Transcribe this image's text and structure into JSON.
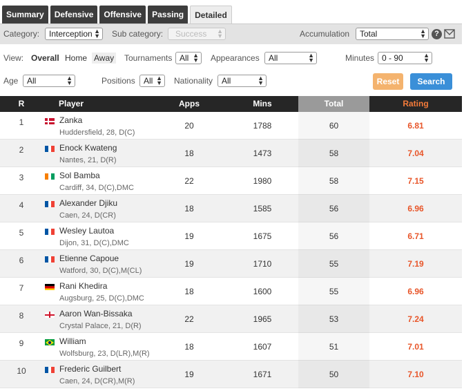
{
  "tabs": [
    {
      "label": "Summary",
      "active": false
    },
    {
      "label": "Defensive",
      "active": false
    },
    {
      "label": "Offensive",
      "active": false
    },
    {
      "label": "Passing",
      "active": false
    },
    {
      "label": "Detailed",
      "active": true
    }
  ],
  "filters": {
    "category_label": "Category:",
    "category_value": "Interception",
    "subcategory_label": "Sub category:",
    "subcategory_value": "Success",
    "accumulation_label": "Accumulation",
    "accumulation_value": "Total",
    "help_text": "?",
    "view_label": "View:",
    "view_options": [
      "Overall",
      "Home",
      "Away"
    ],
    "tournaments_label": "Tournaments",
    "tournaments_value": "All",
    "appearances_label": "Appearances",
    "appearances_value": "All",
    "minutes_label": "Minutes",
    "minutes_value": "0 - 90",
    "age_label": "Age",
    "age_value": "All",
    "positions_label": "Positions",
    "positions_value": "All",
    "nationality_label": "Nationality",
    "nationality_value": "All",
    "reset_label": "Reset",
    "search_label": "Search"
  },
  "table": {
    "headers": {
      "rank": "R",
      "player": "Player",
      "apps": "Apps",
      "mins": "Mins",
      "total": "Total",
      "rating": "Rating"
    },
    "rows": [
      {
        "rank": "1",
        "name": "Zanka",
        "info": "Huddersfield, 28, D(C)",
        "flag": "denmark",
        "apps": "20",
        "mins": "1788",
        "total": "60",
        "rating": "6.81"
      },
      {
        "rank": "2",
        "name": "Enock Kwateng",
        "info": "Nantes, 21, D(R)",
        "flag": "france",
        "apps": "18",
        "mins": "1473",
        "total": "58",
        "rating": "7.04"
      },
      {
        "rank": "3",
        "name": "Sol Bamba",
        "info": "Cardiff, 34, D(C),DMC",
        "flag": "ivory-coast",
        "apps": "22",
        "mins": "1980",
        "total": "58",
        "rating": "7.15"
      },
      {
        "rank": "4",
        "name": "Alexander Djiku",
        "info": "Caen, 24, D(CR)",
        "flag": "france",
        "apps": "18",
        "mins": "1585",
        "total": "56",
        "rating": "6.96"
      },
      {
        "rank": "5",
        "name": "Wesley Lautoa",
        "info": "Dijon, 31, D(C),DMC",
        "flag": "france",
        "apps": "19",
        "mins": "1675",
        "total": "56",
        "rating": "6.71"
      },
      {
        "rank": "6",
        "name": "Etienne Capoue",
        "info": "Watford, 30, D(C),M(CL)",
        "flag": "france",
        "apps": "19",
        "mins": "1710",
        "total": "55",
        "rating": "7.19"
      },
      {
        "rank": "7",
        "name": "Rani Khedira",
        "info": "Augsburg, 25, D(C),DMC",
        "flag": "germany",
        "apps": "18",
        "mins": "1600",
        "total": "55",
        "rating": "6.96"
      },
      {
        "rank": "8",
        "name": "Aaron Wan-Bissaka",
        "info": "Crystal Palace, 21, D(R)",
        "flag": "england",
        "apps": "22",
        "mins": "1965",
        "total": "53",
        "rating": "7.24"
      },
      {
        "rank": "9",
        "name": "William",
        "info": "Wolfsburg, 23, D(LR),M(R)",
        "flag": "brazil",
        "apps": "18",
        "mins": "1607",
        "total": "51",
        "rating": "7.01"
      },
      {
        "rank": "10",
        "name": "Frederic Guilbert",
        "info": "Caen, 24, D(CR),M(R)",
        "flag": "france",
        "apps": "19",
        "mins": "1671",
        "total": "50",
        "rating": "7.10"
      }
    ]
  },
  "colors": {
    "header_bg": "#262626",
    "rating": "#e8562a",
    "reset": "#f4b36e",
    "search": "#3a8fd8"
  }
}
